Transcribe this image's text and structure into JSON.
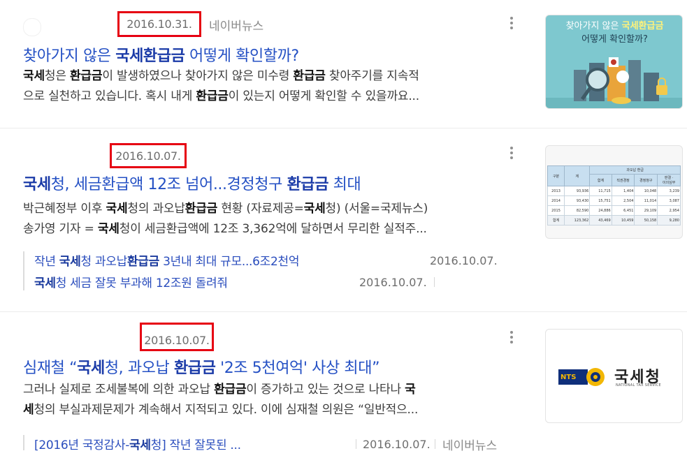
{
  "results": [
    {
      "date": "2016.10.31.",
      "press": "네이버뉴스",
      "title_parts": [
        "찾아가지 않은 ",
        "국세환급금",
        " 어떻게 확인할까?"
      ],
      "desc_line1_parts": [
        "국세",
        "청은 ",
        "환급금",
        "이 발생하였으나 찾아가지 않은 미수령 ",
        "환급금",
        " 찾아주기를 지속적"
      ],
      "desc_line2_parts": [
        "으로 실천하고 있습니다. 혹시 내게 ",
        "환급금",
        "이 있는지 어떻게 확인할 수 있을까요..."
      ],
      "thumb": {
        "line1a": "찾아가지 않은 ",
        "line1b": "국세환급금",
        "line2": "어떻게 확인할까?"
      }
    },
    {
      "date": "2016.10.07.",
      "title_parts": [
        "국세",
        "청, 세금환급액 12조 넘어...경정청구 ",
        "환급금",
        " 최대"
      ],
      "desc_line1_parts": [
        "박근혜정부 이후 ",
        "국세",
        "청의 과오납",
        "환급금",
        " 현황 (자료제공=",
        "국세",
        "청) (서울=국제뉴스)"
      ],
      "desc_line2_parts": [
        "송가영 기자 = ",
        "국세",
        "청이 세금환급액에 12조 3,362억에 달하면서 무리한 실적주..."
      ],
      "sub_items": [
        {
          "parts": [
            "작년 ",
            "국세",
            "청 과오납",
            "환급금",
            " 3년내 최대 규모...6조2천억"
          ],
          "date": "2016.10.07."
        },
        {
          "parts": [
            "국세",
            "청 세금 잘못 부과해 12조원 돌려줘"
          ],
          "date": "2016.10.07."
        }
      ],
      "thumb_table": {
        "headers": [
          "구분",
          "계",
          "과오납 환급"
        ],
        "subheaders": [
          "합계",
          "직권경정",
          "경정청구",
          "판결 ·\n이의심부"
        ],
        "rows": [
          [
            "2013",
            "93,936",
            "11,715",
            "1,404",
            "10,048",
            "3,239"
          ],
          [
            "2014",
            "93,430",
            "15,751",
            "2,504",
            "11,014",
            "3,087"
          ],
          [
            "2015",
            "82,590",
            "24,886",
            "6,451",
            "29,109",
            "2,954"
          ],
          [
            "합계",
            "123,362",
            "43,469",
            "10,459",
            "50,158",
            "9,280"
          ]
        ]
      }
    },
    {
      "date": "2016.10.07.",
      "title_parts": [
        "심재철 “",
        "국세",
        "청, 과오납 ",
        "환급금",
        " '2조 5천여억' 사상 최대”"
      ],
      "desc_line1_parts": [
        "그러나 실제로 조세불복에 의한 과오납 ",
        "환급금",
        "이 증가하고 있는 것으로 나타나 ",
        "국"
      ],
      "desc_line2_parts": [
        "세",
        "청의 부실과제문제가 계속해서 지적되고 있다. 이에 심재철 의원은 “일반적으..."
      ],
      "sub_item": {
        "parts": [
          "[2016년 국정감사-",
          "국세",
          "청] 작년 잘못된 ..."
        ],
        "date": "2016.10.07.",
        "press": "네이버뉴스"
      },
      "thumb_logo": {
        "nts": "NTS",
        "name": "국세청",
        "sub": "NATIONAL TAX SERVICE"
      }
    }
  ],
  "colors": {
    "highlight_box": "#e60012",
    "link": "#2450c4"
  }
}
